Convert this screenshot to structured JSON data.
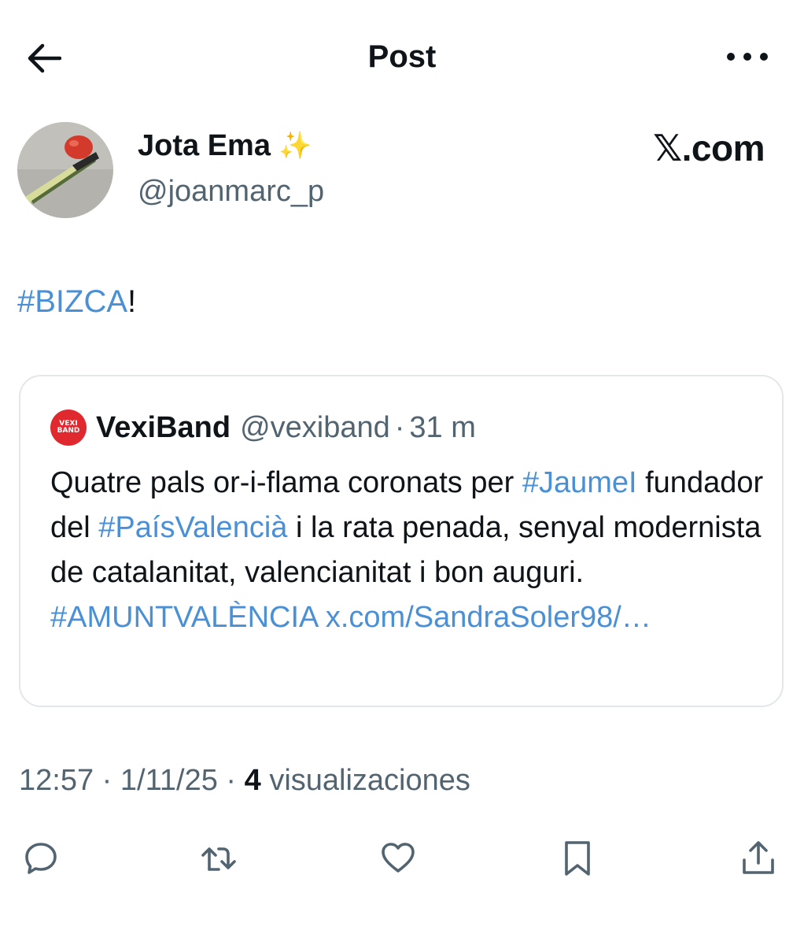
{
  "header": {
    "title": "Post"
  },
  "author": {
    "name": "Jota Ema",
    "badge": "✨",
    "handle": "@joanmarc_p",
    "source": "𝕏.com"
  },
  "post": {
    "hashtag": "#BIZCA",
    "suffix": "!"
  },
  "quote": {
    "logo_text": "VEXI BAND",
    "name": "VexiBand",
    "handle": "@vexiband",
    "separator": "·",
    "time": "31 m",
    "text_1": "Quatre pals or-i-flama coronats per ",
    "tag_1": "#JaumeI",
    "text_2": " fundador del ",
    "tag_2": "#PaísValencià",
    "text_3": " i la rata penada, senyal modernista de catalanitat, valencianitat i bon auguri. ",
    "tag_3": "#AMUNTVALÈNCIA",
    "link": "x.com/SandraSoler98/…"
  },
  "meta": {
    "time": "12:57",
    "sep1": " · ",
    "date": "1/11/25",
    "sep2": " · ",
    "views": "4",
    "views_label": " visualizaciones"
  },
  "actions": {
    "reply": "reply-icon",
    "repost": "repost-icon",
    "like": "heart-icon",
    "bookmark": "bookmark-icon",
    "share": "share-icon"
  },
  "colors": {
    "link": "#4a90d6",
    "secondary": "#536471",
    "text": "#0f1419",
    "border": "#e3e7ea",
    "vexiband": "#e0292f"
  }
}
